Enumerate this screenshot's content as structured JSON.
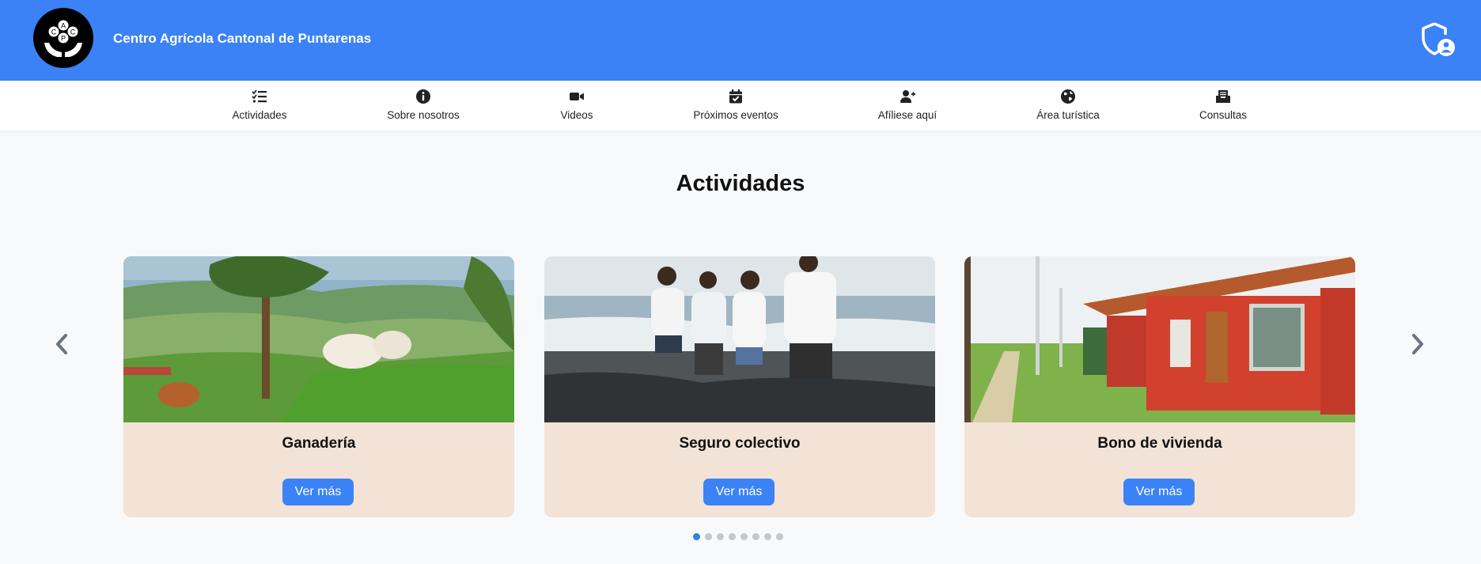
{
  "header": {
    "title": "Centro Agrícola Cantonal de Puntarenas",
    "logo_letters": [
      "C",
      "A",
      "C",
      "P"
    ],
    "admin_icon": "shield-user-icon",
    "colors": {
      "header_bg": "#3b82f6",
      "accent": "#3b82f6"
    }
  },
  "nav": {
    "items": [
      {
        "label": "Actividades",
        "icon": "checklist-icon"
      },
      {
        "label": "Sobre nosotros",
        "icon": "info-icon"
      },
      {
        "label": "Videos",
        "icon": "video-icon"
      },
      {
        "label": "Próximos eventos",
        "icon": "calendar-check-icon"
      },
      {
        "label": "Afíliese aquí",
        "icon": "user-plus-icon"
      },
      {
        "label": "Área turística",
        "icon": "globe-icon"
      },
      {
        "label": "Consultas",
        "icon": "inbox-icon"
      }
    ]
  },
  "main": {
    "section_title": "Actividades",
    "cards": [
      {
        "title": "Ganadería",
        "button": "Ver más",
        "image": "cattle-on-hillside"
      },
      {
        "title": "Seguro colectivo",
        "button": "Ver más",
        "image": "family-at-beach"
      },
      {
        "title": "Bono de vivienda",
        "button": "Ver más",
        "image": "red-houses"
      }
    ],
    "carousel": {
      "total_pages": 8,
      "active_page": 1
    }
  }
}
